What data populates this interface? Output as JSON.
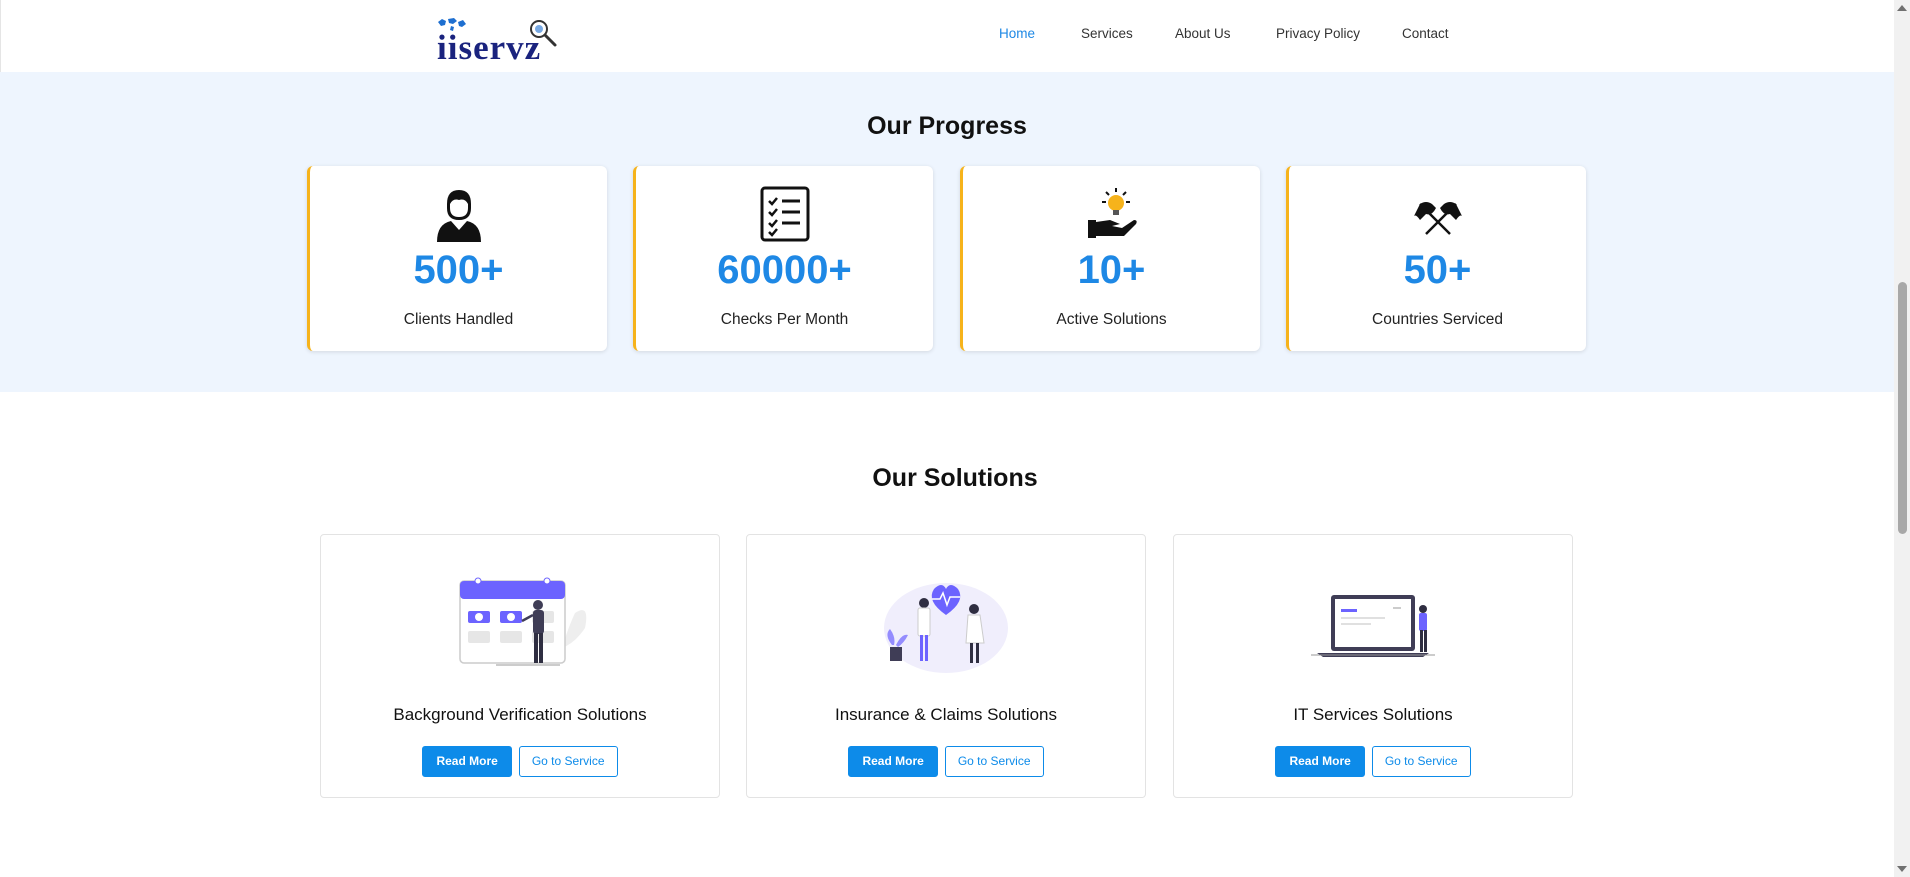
{
  "brand": {
    "logo_text": "iiservz"
  },
  "nav": {
    "items": [
      {
        "label": "Home",
        "active": true
      },
      {
        "label": "Services"
      },
      {
        "label": "About Us"
      },
      {
        "label": "Privacy Policy"
      },
      {
        "label": "Contact"
      }
    ]
  },
  "progress": {
    "title": "Our Progress",
    "stats": [
      {
        "value": "500+",
        "label": "Clients Handled",
        "icon": "person-icon"
      },
      {
        "value": "60000+",
        "label": "Checks Per Month",
        "icon": "checklist-icon"
      },
      {
        "value": "10+",
        "label": "Active Solutions",
        "icon": "idea-hand-icon"
      },
      {
        "value": "50+",
        "label": "Countries Serviced",
        "icon": "flags-icon"
      }
    ]
  },
  "solutions": {
    "title": "Our Solutions",
    "cards": [
      {
        "title": "Background Verification Solutions",
        "read_more": "Read More",
        "go_to": "Go to Service"
      },
      {
        "title": "Insurance & Claims Solutions",
        "read_more": "Read More",
        "go_to": "Go to Service"
      },
      {
        "title": "IT Services Solutions",
        "read_more": "Read More",
        "go_to": "Go to Service"
      }
    ]
  },
  "colors": {
    "accent": "#1e88e5",
    "button": "#0d8be9",
    "card_border": "#f6b31b",
    "band_bg": "#eef5fe"
  }
}
